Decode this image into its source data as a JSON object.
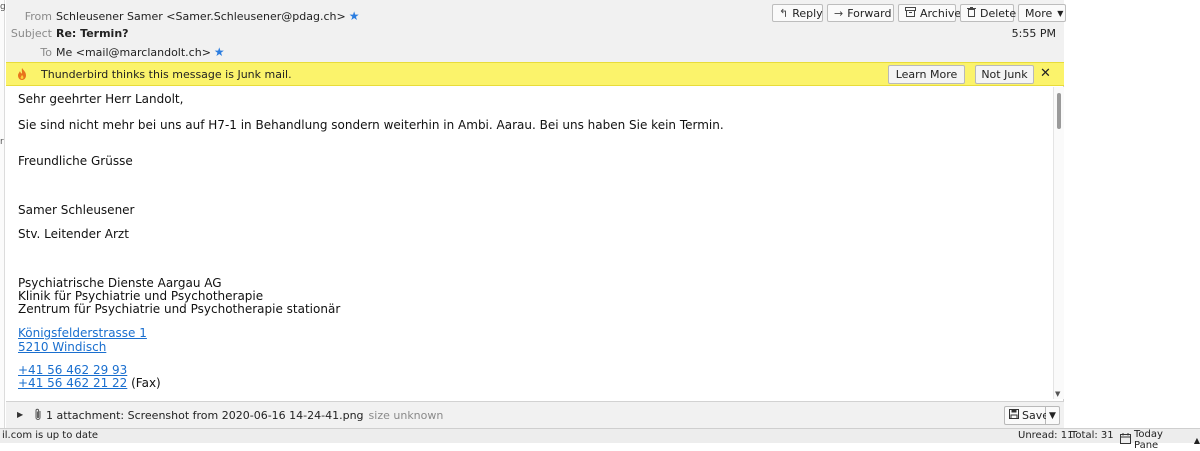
{
  "left_fragments": [
    "g",
    "r"
  ],
  "header": {
    "from_label": "From",
    "from_value": "Schleusener Samer <Samer.Schleusener@pdag.ch>",
    "subject_label": "Subject",
    "subject_value": "Re: Termin?",
    "to_label": "To",
    "to_value": "Me <mail@marclandolt.ch>",
    "time": "5:55 PM",
    "buttons": {
      "reply": "Reply",
      "forward": "Forward",
      "archive": "Archive",
      "delete": "Delete",
      "more": "More"
    }
  },
  "junk_bar": {
    "message": "Thunderbird thinks this message is Junk mail.",
    "learn_more": "Learn More",
    "not_junk": "Not Junk",
    "close": "✕"
  },
  "body": {
    "greeting": "Sehr geehrter Herr Landolt,",
    "paragraph": "Sie sind nicht mehr bei uns auf H7-1 in Behandlung sondern weiterhin in Ambi. Aarau. Bei uns haben Sie kein Termin.",
    "closing": "Freundliche Grüsse",
    "name": "Samer Schleusener",
    "title": "Stv. Leitender Arzt",
    "org1": "Psychiatrische Dienste Aargau AG",
    "org2": "Klinik für Psychiatrie und Psychotherapie",
    "org3": "Zentrum für Psychiatrie und Psychotherapie stationär",
    "street": "Königsfelderstrasse 1",
    "city": "5210 Windisch",
    "phone": "+41 56 462 29 93",
    "fax_number": "+41 56 462 21 22",
    "fax_label": " (Fax)"
  },
  "attachment": {
    "summary": "1 attachment: Screenshot from 2020-06-16 14-24-41.png",
    "size": "size unknown",
    "save": "Save"
  },
  "status_bar": {
    "left": "il.com is up to date",
    "unread": "Unread: 11",
    "total": "Total: 31",
    "today_pane": "Today Pane"
  },
  "colors": {
    "junk_bar": "#fbf36b",
    "link": "#1a6fcf",
    "star": "#2b7de0"
  },
  "icons": [
    "reply-icon",
    "forward-icon",
    "archive-icon",
    "delete-icon",
    "chevron-down-icon",
    "flame-icon",
    "close-icon",
    "star-icon",
    "paperclip-icon",
    "save-icon",
    "calendar-icon"
  ]
}
